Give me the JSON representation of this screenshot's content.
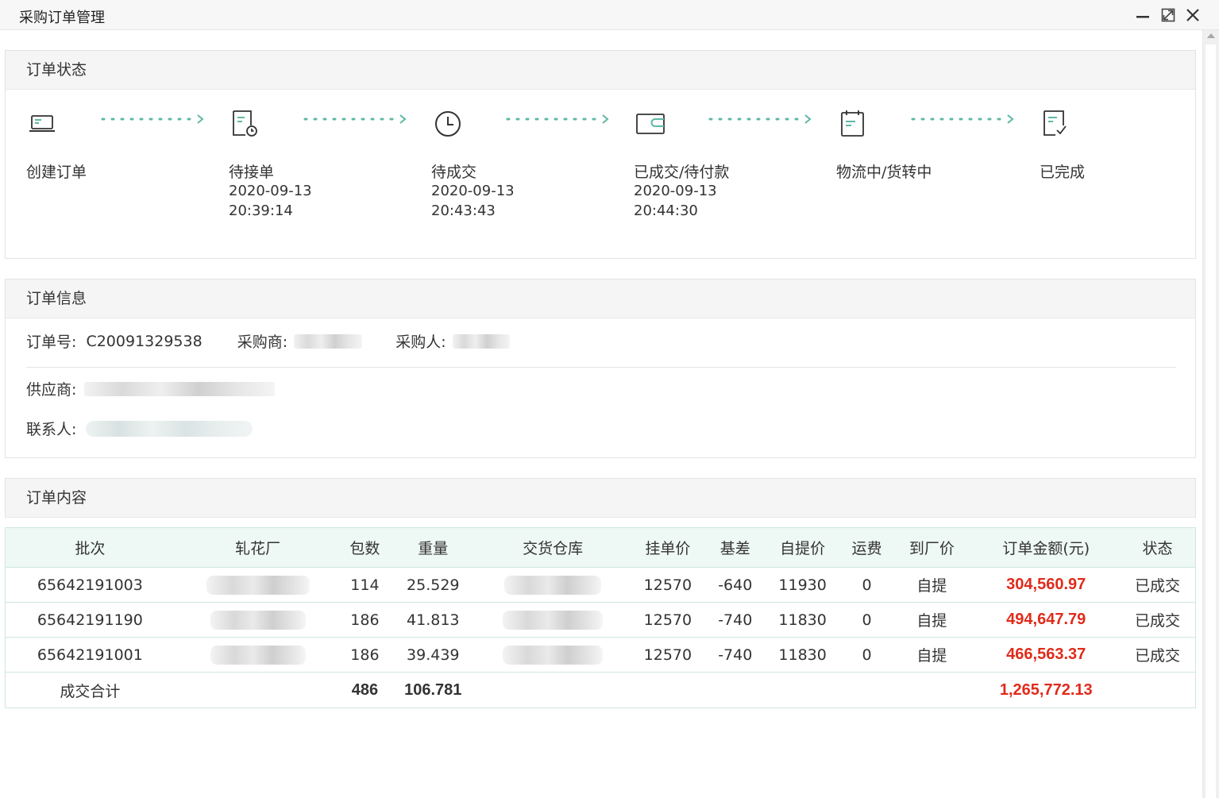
{
  "window": {
    "title": "采购订单管理",
    "icons": [
      "minimize-icon",
      "maximize-icon",
      "close-icon"
    ]
  },
  "status_panel": {
    "title": "订单状态",
    "steps": [
      {
        "label": "创建订单",
        "date": "",
        "time": "",
        "icon": "laptop-icon"
      },
      {
        "label": "待接单",
        "date": "2020-09-13",
        "time": "20:39:14",
        "icon": "document-clock-icon"
      },
      {
        "label": "待成交",
        "date": "2020-09-13",
        "time": "20:43:43",
        "icon": "clock-icon"
      },
      {
        "label": "已成交/待付款",
        "date": "2020-09-13",
        "time": "20:44:30",
        "icon": "wallet-icon"
      },
      {
        "label": "物流中/货转中",
        "date": "",
        "time": "",
        "icon": "clipboard-icon"
      },
      {
        "label": "已完成",
        "date": "",
        "time": "",
        "icon": "document-check-icon"
      }
    ],
    "accent": "#5fb8a6"
  },
  "info_panel": {
    "title": "订单信息",
    "order_no_label": "订单号:",
    "order_no": "C20091329538",
    "buyer_label": "采购商:",
    "purchaser_label": "采购人:",
    "supplier_label": "供应商:",
    "contact_label": "联系人:"
  },
  "content_panel": {
    "title": "订单内容"
  },
  "table": {
    "headers": [
      "批次",
      "轧花厂",
      "包数",
      "重量",
      "交货仓库",
      "挂单价",
      "基差",
      "自提价",
      "运费",
      "到厂价",
      "订单金额(元)",
      "状态"
    ],
    "rows": [
      {
        "batch": "65642191003",
        "bales": "114",
        "weight": "25.529",
        "list_price": "12570",
        "basis": "-640",
        "pickup_price": "11930",
        "freight": "0",
        "factory_price": "自提",
        "amount": "304,560.97",
        "status": "已成交"
      },
      {
        "batch": "65642191190",
        "bales": "186",
        "weight": "41.813",
        "list_price": "12570",
        "basis": "-740",
        "pickup_price": "11830",
        "freight": "0",
        "factory_price": "自提",
        "amount": "494,647.79",
        "status": "已成交"
      },
      {
        "batch": "65642191001",
        "bales": "186",
        "weight": "39.439",
        "list_price": "12570",
        "basis": "-740",
        "pickup_price": "11830",
        "freight": "0",
        "factory_price": "自提",
        "amount": "466,563.37",
        "status": "已成交"
      }
    ],
    "total": {
      "label": "成交合计",
      "bales": "486",
      "weight": "106.781",
      "amount": "1,265,772.13"
    },
    "amount_color": "#e02b1a",
    "header_bg": "#eef8f5"
  }
}
